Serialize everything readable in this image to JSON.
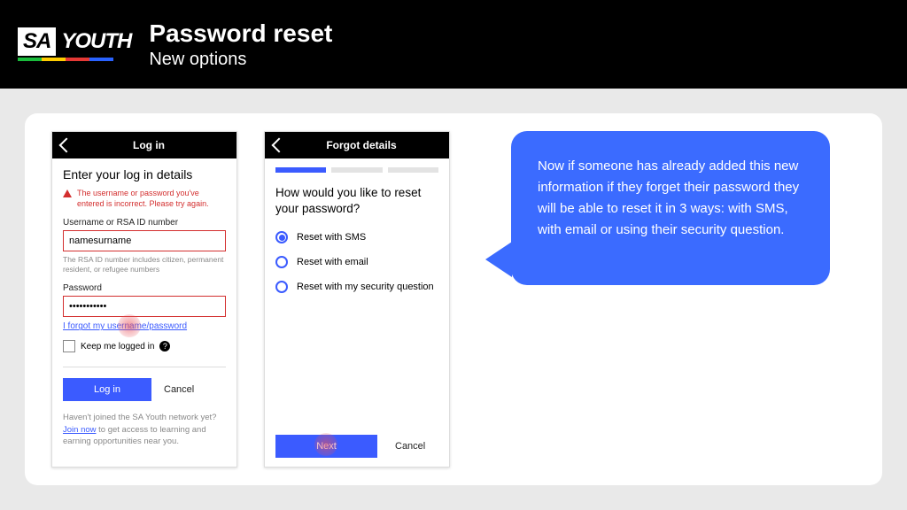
{
  "header": {
    "logo_sa": "SA",
    "logo_youth": "YOUTH",
    "title": "Password reset",
    "subtitle": "New options",
    "stripe_colors": [
      "#1abc3c",
      "#ffcc00",
      "#e53935",
      "#2962ff"
    ]
  },
  "login": {
    "screen_title": "Log in",
    "heading": "Enter your log in details",
    "error_msg": "The username or password you've entered is incorrect. Please try again.",
    "username_label": "Username or RSA ID number",
    "username_value": "namesurname",
    "username_help": "The RSA ID number includes citizen, permanent resident, or refugee numbers",
    "password_label": "Password",
    "password_value": "•••••••••••",
    "forgot_link": "I forgot my username/password",
    "keep_logged_label": "Keep me logged in",
    "login_btn": "Log in",
    "cancel_btn": "Cancel",
    "join_prefix": "Haven't joined the SA Youth network yet? ",
    "join_link": "Join now",
    "join_suffix": " to get access to learning and earning opportunities near you."
  },
  "forgot": {
    "screen_title": "Forgot details",
    "heading": "How would you like to reset your password?",
    "options": [
      {
        "label": "Reset with SMS",
        "selected": true
      },
      {
        "label": "Reset with email",
        "selected": false
      },
      {
        "label": "Reset with my security question",
        "selected": false
      }
    ],
    "next_btn": "Next",
    "cancel_btn": "Cancel"
  },
  "callout": {
    "text": "Now if someone has already added this new information if they forget their password they will be able to reset it in 3 ways: with SMS, with email or using their security question."
  }
}
